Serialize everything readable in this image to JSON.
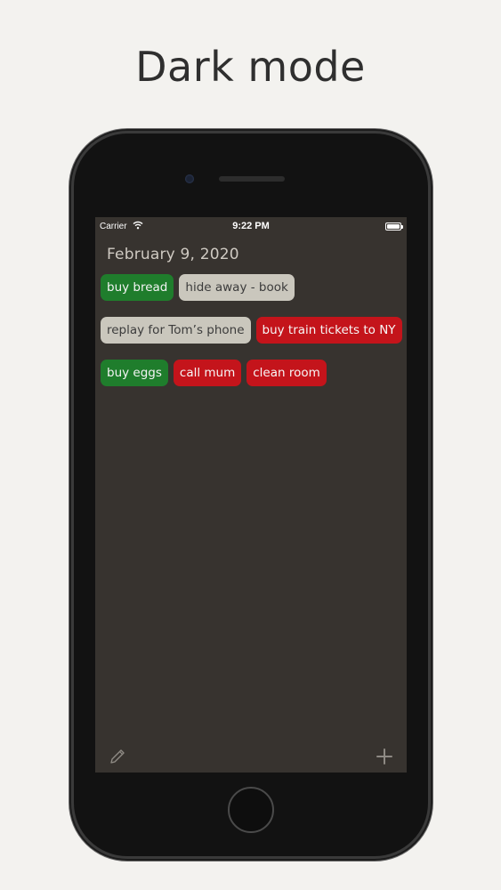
{
  "headline": "Dark mode",
  "status_bar": {
    "carrier": "Carrier",
    "time": "9:22 PM",
    "wifi_icon": "wifi-icon",
    "battery_icon": "battery-icon"
  },
  "date": "February 9, 2020",
  "tasks": [
    {
      "label": "buy bread",
      "status": "green"
    },
    {
      "label": "hide away - book",
      "status": "grey"
    },
    {
      "label": "replay for Tom’s phone",
      "status": "grey"
    },
    {
      "label": "buy train tickets to NY",
      "status": "red"
    },
    {
      "label": "buy eggs",
      "status": "green"
    },
    {
      "label": "call mum",
      "status": "red"
    },
    {
      "label": "clean room",
      "status": "red"
    }
  ],
  "toolbar": {
    "edit_icon": "pencil-icon",
    "add_icon": "plus-icon"
  },
  "colors": {
    "page_background": "#f3f2ef",
    "screen_background": "#37332f",
    "green": "#1f7d2c",
    "grey": "#cac7bd",
    "red": "#c4141b"
  }
}
